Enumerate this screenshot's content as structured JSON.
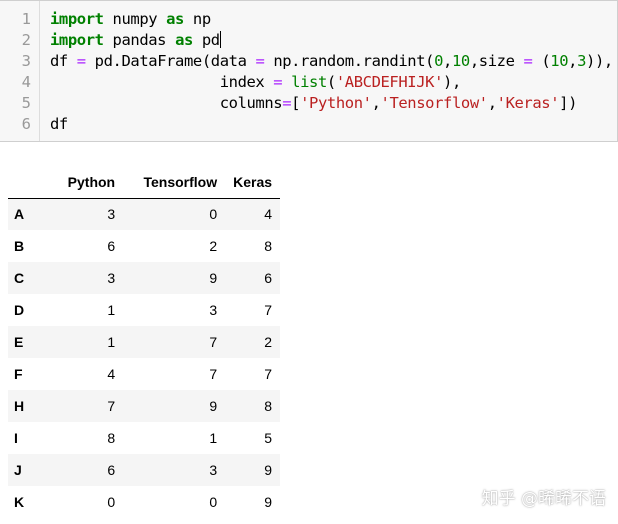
{
  "code_cell": {
    "line_numbers": [
      "1",
      "2",
      "3",
      "4",
      "5",
      "6"
    ],
    "lines": [
      [
        {
          "t": "import",
          "c": "kw"
        },
        {
          "t": " numpy ",
          "c": ""
        },
        {
          "t": "as",
          "c": "kw"
        },
        {
          "t": " np",
          "c": ""
        }
      ],
      [
        {
          "t": "import",
          "c": "kw"
        },
        {
          "t": " pandas ",
          "c": ""
        },
        {
          "t": "as",
          "c": "kw"
        },
        {
          "t": " pd",
          "c": ""
        }
      ],
      [
        {
          "t": "df ",
          "c": ""
        },
        {
          "t": "=",
          "c": "op"
        },
        {
          "t": " pd.DataFrame(data ",
          "c": ""
        },
        {
          "t": "=",
          "c": "op"
        },
        {
          "t": " np.random.randint(",
          "c": ""
        },
        {
          "t": "0",
          "c": "num"
        },
        {
          "t": ",",
          "c": ""
        },
        {
          "t": "10",
          "c": "num"
        },
        {
          "t": ",size ",
          "c": ""
        },
        {
          "t": "=",
          "c": "op"
        },
        {
          "t": " (",
          "c": ""
        },
        {
          "t": "10",
          "c": "num"
        },
        {
          "t": ",",
          "c": ""
        },
        {
          "t": "3",
          "c": "num"
        },
        {
          "t": ")),",
          "c": ""
        }
      ],
      [
        {
          "t": "                   index ",
          "c": ""
        },
        {
          "t": "=",
          "c": "op"
        },
        {
          "t": " ",
          "c": ""
        },
        {
          "t": "list",
          "c": "fn"
        },
        {
          "t": "(",
          "c": ""
        },
        {
          "t": "'ABCDEFHIJK'",
          "c": "str"
        },
        {
          "t": "),",
          "c": ""
        }
      ],
      [
        {
          "t": "                   columns",
          "c": ""
        },
        {
          "t": "=",
          "c": "op"
        },
        {
          "t": "[",
          "c": ""
        },
        {
          "t": "'Python'",
          "c": "str"
        },
        {
          "t": ",",
          "c": ""
        },
        {
          "t": "'Tensorflow'",
          "c": "str"
        },
        {
          "t": ",",
          "c": ""
        },
        {
          "t": "'Keras'",
          "c": "str"
        },
        {
          "t": "])",
          "c": ""
        }
      ],
      [
        {
          "t": "df",
          "c": ""
        }
      ]
    ]
  },
  "dataframe": {
    "columns": [
      "Python",
      "Tensorflow",
      "Keras"
    ],
    "rows": [
      {
        "index": "A",
        "values": [
          "3",
          "0",
          "4"
        ]
      },
      {
        "index": "B",
        "values": [
          "6",
          "2",
          "8"
        ]
      },
      {
        "index": "C",
        "values": [
          "3",
          "9",
          "6"
        ]
      },
      {
        "index": "D",
        "values": [
          "1",
          "3",
          "7"
        ]
      },
      {
        "index": "E",
        "values": [
          "1",
          "7",
          "2"
        ]
      },
      {
        "index": "F",
        "values": [
          "4",
          "7",
          "7"
        ]
      },
      {
        "index": "H",
        "values": [
          "7",
          "9",
          "8"
        ]
      },
      {
        "index": "I",
        "values": [
          "8",
          "1",
          "5"
        ]
      },
      {
        "index": "J",
        "values": [
          "6",
          "3",
          "9"
        ]
      },
      {
        "index": "K",
        "values": [
          "0",
          "0",
          "9"
        ]
      }
    ]
  },
  "watermark": {
    "text": "知乎 @晞晞不语"
  }
}
